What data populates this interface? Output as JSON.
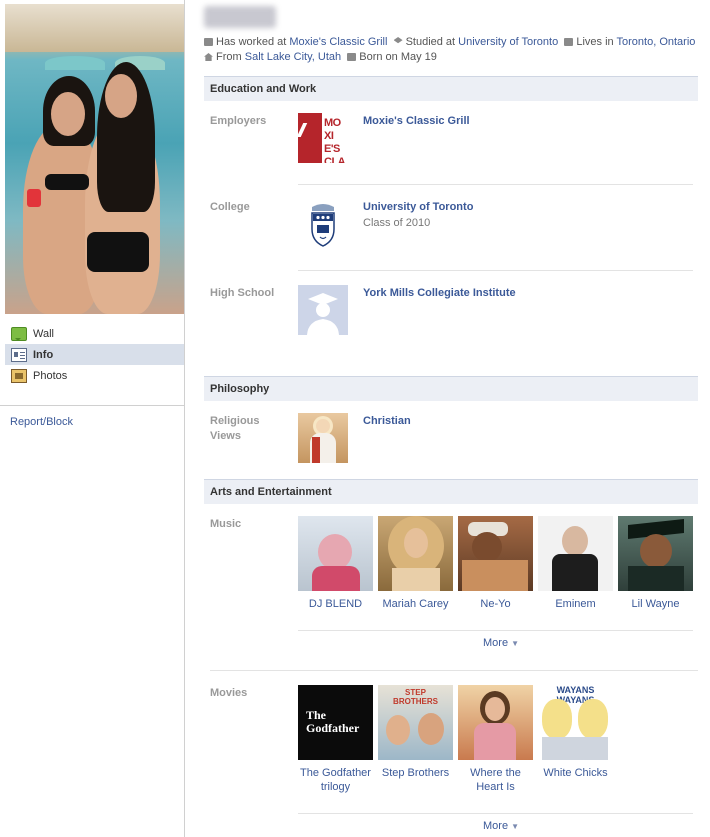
{
  "profile": {
    "name": "",
    "summary": [
      {
        "icon": "briefcase-icon",
        "prefix": "Has worked at ",
        "link": "Moxie's Classic Grill",
        "suffix": ""
      },
      {
        "icon": "graduation-cap-icon",
        "prefix": "Studied at ",
        "link": "University of Toronto",
        "suffix": ""
      },
      {
        "icon": "home-icon",
        "prefix": "Lives in ",
        "link": "Toronto, Ontario",
        "suffix": ""
      },
      {
        "icon": "house-icon",
        "prefix": "From ",
        "link": "Salt Lake City, Utah",
        "suffix": ""
      },
      {
        "icon": "calendar-icon",
        "prefix": "Born on May 19",
        "link": "",
        "suffix": ""
      }
    ]
  },
  "sidebar": {
    "items": [
      {
        "label": "Wall",
        "icon": "wall-icon",
        "active": false
      },
      {
        "label": "Info",
        "icon": "info-icon",
        "active": true
      },
      {
        "label": "Photos",
        "icon": "photos-icon",
        "active": false
      }
    ],
    "report_block": "Report/Block"
  },
  "sections": {
    "education": {
      "header": "Education and Work",
      "employers_label": "Employers",
      "employer": "Moxie's Classic Grill",
      "employer_logo_text": "MOXIE'S CLASSIC GRILL",
      "college_label": "College",
      "college": "University of Toronto",
      "college_class": "Class of 2010",
      "highschool_label": "High School",
      "highschool": "York Mills Collegiate Institute"
    },
    "philosophy": {
      "header": "Philosophy",
      "religious_label": "Religious Views",
      "religion": "Christian"
    },
    "arts": {
      "header": "Arts and Entertainment",
      "music_label": "Music",
      "music": [
        "DJ BLEND",
        "Mariah Carey",
        "Ne-Yo",
        "Eminem",
        "Lil Wayne"
      ],
      "music_more": "More",
      "movies_label": "Movies",
      "movies": [
        "The Godfather trilogy",
        "Step Brothers",
        "Where the Heart Is",
        "White Chicks"
      ],
      "movie_poster_text": [
        "The Godfather",
        "STEP BROTHERS",
        "",
        "WAYANS WAYANS"
      ],
      "movies_more": "More"
    }
  },
  "colors": {
    "link": "#3b5998",
    "section_header_bg": "#eceff5",
    "nav_active_bg": "#d8dfea",
    "label_gray": "#999999",
    "moxies_red": "#b5252b"
  }
}
